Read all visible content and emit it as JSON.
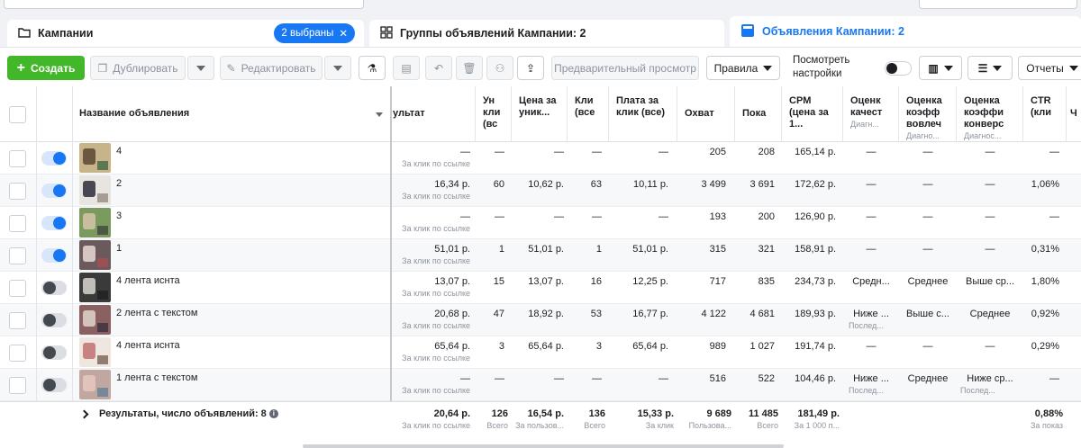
{
  "colors": {
    "accent": "#1877f2",
    "create": "#42b72a"
  },
  "tabs": {
    "campaigns": {
      "label": "Кампании",
      "badge": "2 выбраны",
      "icon": "folder-icon"
    },
    "adsets": {
      "label": "Группы объявлений Кампании: 2",
      "icon": "grid-icon"
    },
    "ads": {
      "label": "Объявления Кампании: 2",
      "icon": "ad-card-icon"
    }
  },
  "toolbar": {
    "create": "Создать",
    "duplicate": "Дублировать",
    "edit": "Редактировать",
    "preview": "Предварительный просмотр",
    "rules": "Правила",
    "view_settings": "Посмотреть настройки",
    "reports": "Отчеты"
  },
  "headers": {
    "name": "Название объявления",
    "result": "ультат",
    "uniq": "Ун кли (вс",
    "price_uniq": "Цена за уник...",
    "clicks": "Кли (все",
    "cpc": "Плата за клик (все)",
    "reach": "Охват",
    "impr": "Пока",
    "cpm": "CPM (цена за 1...",
    "quality": "Оценк качест",
    "quality_sub": "Диагн...",
    "engage": "Оценка коэфф вовлеч",
    "engage_sub": "Диагно...",
    "conv": "Оценка коэффи конверс",
    "conv_sub": "Диагнос...",
    "ctr": "CTR (кли",
    "more": "Ч"
  },
  "rows": [
    {
      "on": true,
      "name": "4",
      "result": "—",
      "result_sub": "За клик по ссылке",
      "uniq": "—",
      "price_uniq": "—",
      "clicks": "—",
      "cpc": "—",
      "reach": "205",
      "impr": "208",
      "cpm": "165,14 р.",
      "quality": "—",
      "quality_sub": "",
      "engage": "—",
      "conv": "—",
      "ctr": "—"
    },
    {
      "on": true,
      "name": "2",
      "result": "16,34 р.",
      "result_sub": "За клик по ссылке",
      "uniq": "60",
      "price_uniq": "10,62 р.",
      "clicks": "63",
      "cpc": "10,11 р.",
      "reach": "3 499",
      "impr": "3 691",
      "cpm": "172,62 р.",
      "quality": "—",
      "quality_sub": "",
      "engage": "—",
      "conv": "—",
      "ctr": "1,06%"
    },
    {
      "on": true,
      "name": "3",
      "result": "—",
      "result_sub": "За клик по ссылке",
      "uniq": "—",
      "price_uniq": "—",
      "clicks": "—",
      "cpc": "—",
      "reach": "193",
      "impr": "200",
      "cpm": "126,90 р.",
      "quality": "—",
      "quality_sub": "",
      "engage": "—",
      "conv": "—",
      "ctr": "—"
    },
    {
      "on": true,
      "name": "1",
      "result": "51,01 р.",
      "result_sub": "За клик по ссылке",
      "uniq": "1",
      "price_uniq": "51,01 р.",
      "clicks": "1",
      "cpc": "51,01 р.",
      "reach": "315",
      "impr": "321",
      "cpm": "158,91 р.",
      "quality": "—",
      "quality_sub": "",
      "engage": "—",
      "conv": "—",
      "ctr": "0,31%"
    },
    {
      "on": false,
      "name": "4 лента иснта",
      "result": "13,07 р.",
      "result_sub": "За клик по ссылке",
      "uniq": "15",
      "price_uniq": "13,07 р.",
      "clicks": "16",
      "cpc": "12,25 р.",
      "reach": "717",
      "impr": "835",
      "cpm": "234,73 р.",
      "quality": "Средн...",
      "quality_sub": "",
      "engage": "Среднее",
      "conv": "Выше ср...",
      "ctr": "1,80%"
    },
    {
      "on": false,
      "name": "2 лента с текстом",
      "result": "20,68 р.",
      "result_sub": "За клик по ссылке",
      "uniq": "47",
      "price_uniq": "18,92 р.",
      "clicks": "53",
      "cpc": "16,77 р.",
      "reach": "4 122",
      "impr": "4 681",
      "cpm": "189,93 р.",
      "quality": "Ниже ...",
      "quality_sub": "Послед...",
      "engage": "Выше с...",
      "conv": "Среднее",
      "ctr": "0,92%"
    },
    {
      "on": false,
      "name": "4 лента иснта",
      "result": "65,64 р.",
      "result_sub": "За клик по ссылке",
      "uniq": "3",
      "price_uniq": "65,64 р.",
      "clicks": "3",
      "cpc": "65,64 р.",
      "reach": "989",
      "impr": "1 027",
      "cpm": "191,74 р.",
      "quality": "—",
      "quality_sub": "",
      "engage": "—",
      "conv": "—",
      "ctr": "0,29%"
    },
    {
      "on": false,
      "name": "1 лента с текстом",
      "result": "—",
      "result_sub": "За клик по ссылке",
      "uniq": "—",
      "price_uniq": "—",
      "clicks": "—",
      "cpc": "—",
      "reach": "516",
      "impr": "522",
      "cpm": "104,46 р.",
      "quality": "Ниже ...",
      "quality_sub": "Послед...",
      "engage": "Среднее",
      "conv": "Ниже ср...",
      "conv_sub": "Послед...",
      "ctr": "—"
    }
  ],
  "footer": {
    "label": "Результаты, число объявлений: 8",
    "result": "20,64 р.",
    "result_sub": "За клик по ссылке",
    "uniq": "126",
    "uniq_sub": "Всего",
    "price_uniq": "16,54 р.",
    "price_uniq_sub": "За пользов...",
    "clicks": "136",
    "clicks_sub": "Всего",
    "cpc": "15,33 р.",
    "cpc_sub": "За клик",
    "reach": "9 689",
    "reach_sub": "Пользова...",
    "impr": "11 485",
    "impr_sub": "Всего",
    "cpm": "181,49 р.",
    "cpm_sub": "За 1 000 п...",
    "ctr": "0,88%",
    "ctr_sub": "За показ"
  }
}
